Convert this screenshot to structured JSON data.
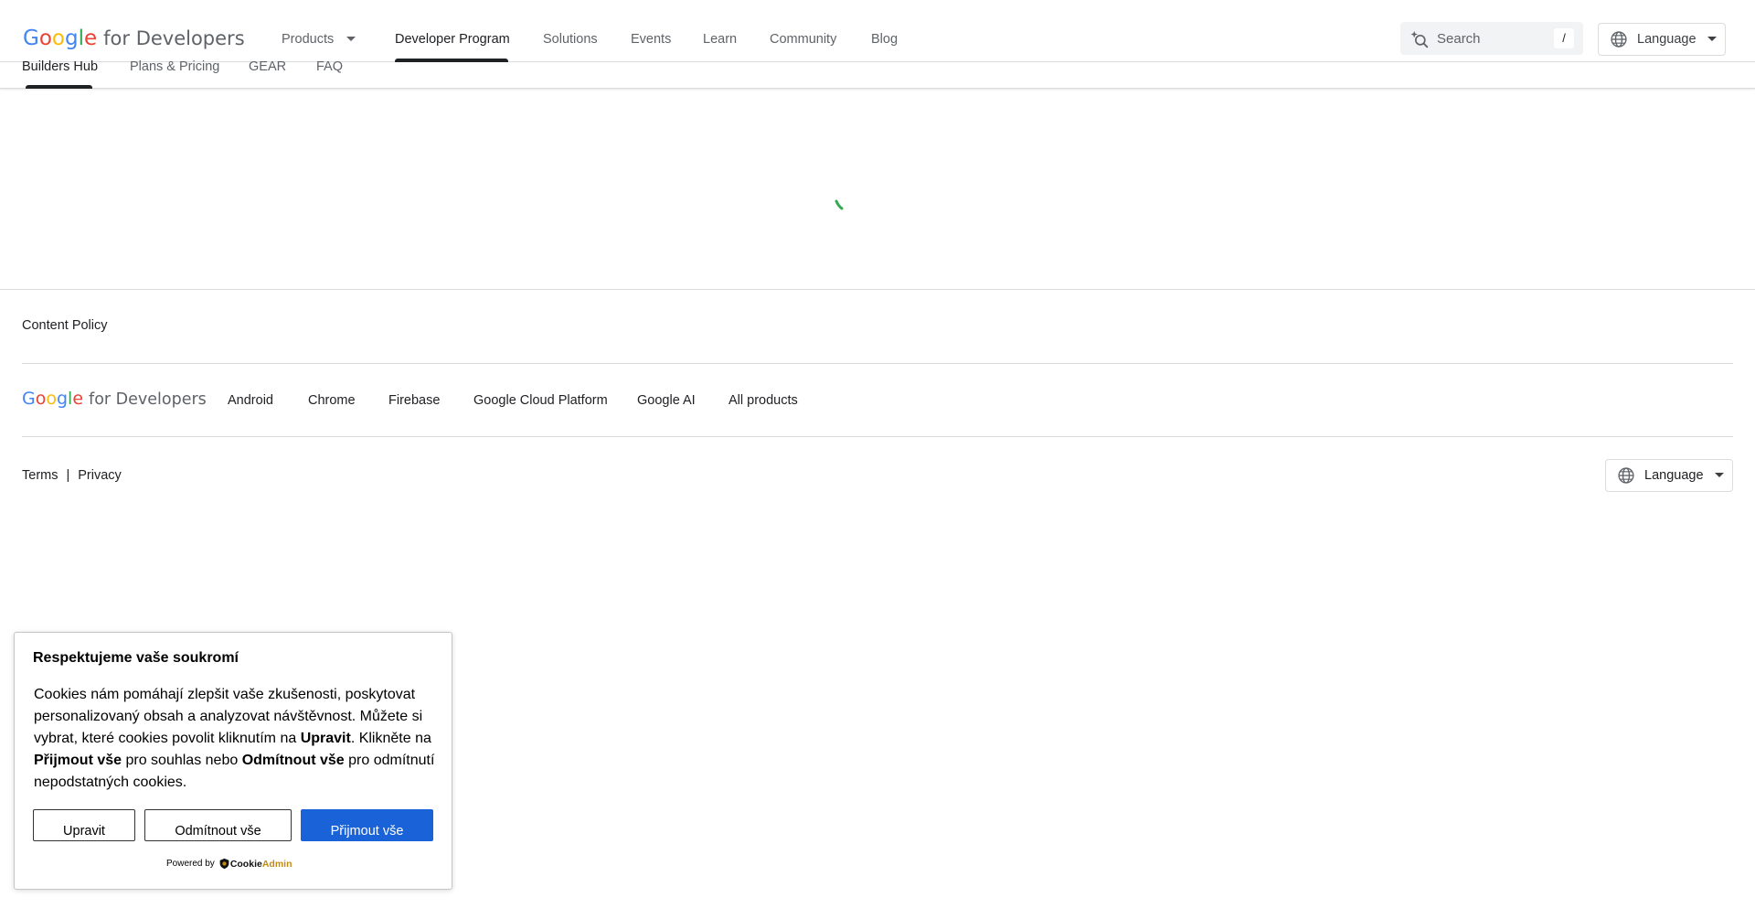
{
  "brand": {
    "logo_letters": [
      "G",
      "o",
      "o",
      "g",
      "l",
      "e"
    ],
    "logo_suffix": "for Developers",
    "logo_colors": [
      "#4285F4",
      "#EA4335",
      "#FBBC05",
      "#4285F4",
      "#34A853",
      "#EA4335"
    ]
  },
  "header": {
    "nav": [
      "Products",
      "Developer Program",
      "Solutions",
      "Events",
      "Learn",
      "Community",
      "Blog"
    ],
    "active_nav": "Developer Program",
    "search_placeholder": "Search",
    "search_shortcut": "/",
    "language_label": "Language"
  },
  "subnav": {
    "items": [
      "Builders Hub",
      "Plans & Pricing",
      "GEAR",
      "FAQ"
    ],
    "active": "Builders Hub"
  },
  "main": {
    "spinner_color": "#34A853"
  },
  "footer": {
    "content_policy": "Content Policy",
    "links": [
      "Android",
      "Chrome",
      "Firebase",
      "Google Cloud Platform",
      "Google AI",
      "All products"
    ],
    "terms": "Terms",
    "separator": "|",
    "privacy": "Privacy",
    "language_label": "Language"
  },
  "cookie": {
    "title": "Respektujeme vaše soukromí",
    "body_1": "Cookies nám pomáhají zlepšit vaše zkušenosti, poskytovat personalizovaný obsah a analyzovat návštěvnost. Můžete si vybrat, které cookies povolit kliknutím na ",
    "body_bold_1": "Upravit",
    "body_2": ". Klikněte na ",
    "body_bold_2": "Přijmout vše",
    "body_3": " pro souhlas nebo ",
    "body_bold_3": "Odmítnout vše",
    "body_4": " pro odmítnutí nepodstatných cookies.",
    "btn_edit": "Upravit",
    "btn_reject": "Odmítnout vše",
    "btn_accept": "Přijmout vše",
    "powered_by": "Powered by",
    "brand_part1": "Cookie",
    "brand_part2": "Admin",
    "accept_color": "#1A62D8"
  }
}
